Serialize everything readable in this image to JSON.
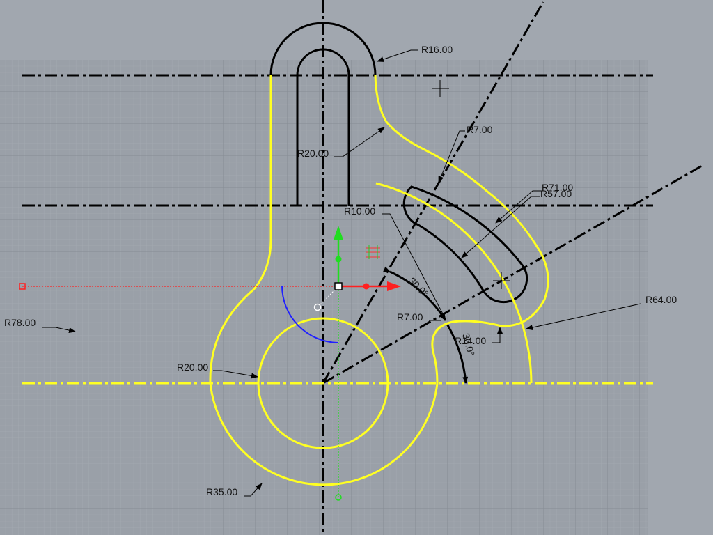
{
  "viewport": {
    "name": "Top",
    "colors": {
      "background": "#a1a7af",
      "grid_area": "#9aa0a8",
      "selected_curve": "#ffff22",
      "curve": "#000000",
      "x_axis": "#ff2020",
      "y_axis": "#20dd20"
    }
  },
  "dimensions": [
    {
      "id": "r16",
      "text": "R16.00"
    },
    {
      "id": "r7-top",
      "text": "R7.00"
    },
    {
      "id": "r20-top",
      "text": "R20.00"
    },
    {
      "id": "r71",
      "text": "R71.00"
    },
    {
      "id": "r57",
      "text": "R57.00"
    },
    {
      "id": "r10",
      "text": "R10.00"
    },
    {
      "id": "angle1",
      "text": "30.0°"
    },
    {
      "id": "r7-bottom",
      "text": "R7.00"
    },
    {
      "id": "r14",
      "text": "R14.00"
    },
    {
      "id": "angle2",
      "text": "30.0°"
    },
    {
      "id": "r64",
      "text": "R64.00"
    },
    {
      "id": "r78",
      "text": "R78.00"
    },
    {
      "id": "r20-center",
      "text": "R20.00"
    },
    {
      "id": "r35",
      "text": "R35.00"
    }
  ],
  "icons": {
    "gumball": "move-gumball-icon",
    "planar": "planar-grid-icon",
    "cursor": "crosshair-cursor-icon"
  }
}
